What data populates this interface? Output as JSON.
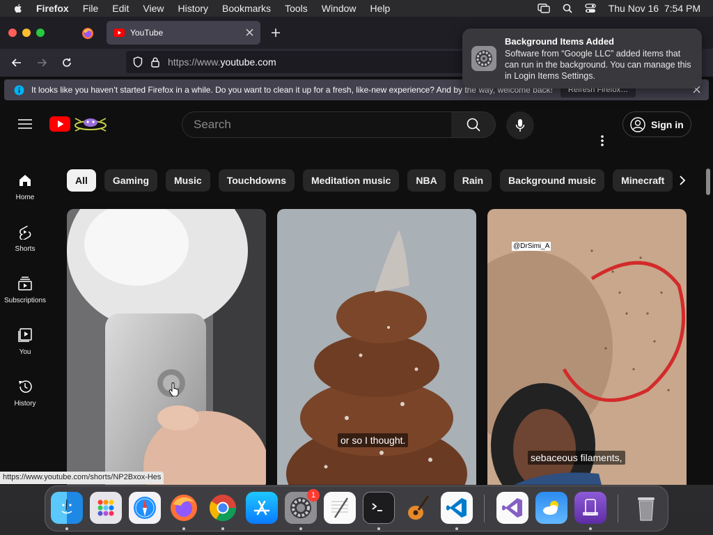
{
  "menubar": {
    "app_name": "Firefox",
    "items": [
      "File",
      "Edit",
      "View",
      "History",
      "Bookmarks",
      "Tools",
      "Window",
      "Help"
    ],
    "clock": "Thu Nov 16  7:54 PM"
  },
  "browser": {
    "tab_title": "YouTube",
    "url_prefix": "https://www.",
    "url_domain": "youtube.com",
    "infobar_text": "It looks like you haven’t started Firefox in a while. Do you want to clean it up for a fresh, like-new experience? And by the way, welcome back!",
    "infobar_button": "Refresh Firefox…",
    "status_link": "https://www.youtube.com/shorts/NP2Bxox-Hes"
  },
  "notification": {
    "title": "Background Items Added",
    "body": "Software from “Google LLC” added items that can run in the background. You can manage this in Login Items Settings."
  },
  "youtube": {
    "search_placeholder": "Search",
    "sign_in": "Sign in",
    "chips": [
      "All",
      "Gaming",
      "Music",
      "Touchdowns",
      "Meditation music",
      "NBA",
      "Rain",
      "Background music",
      "Minecraft"
    ],
    "nav": [
      {
        "label": "Home",
        "icon": "home-icon"
      },
      {
        "label": "Shorts",
        "icon": "shorts-icon"
      },
      {
        "label": "Subscriptions",
        "icon": "subscriptions-icon"
      },
      {
        "label": "You",
        "icon": "you-icon"
      },
      {
        "label": "History",
        "icon": "history-icon"
      }
    ],
    "shorts": [
      {
        "caption": ""
      },
      {
        "caption": "or so I thought."
      },
      {
        "caption": "sebaceous filaments,",
        "watermark": "@DrSimi_A"
      }
    ]
  },
  "dock": {
    "apps": [
      "finder-icon",
      "launchpad-icon",
      "safari-icon",
      "firefox-icon",
      "chrome-icon",
      "app-store-icon",
      "system-settings-icon",
      "textedit-icon",
      "terminal-icon",
      "garageband-icon",
      "vscode-icon",
      "visual-studio-icon",
      "weather-icon",
      "simulator-icon",
      "trash-icon"
    ],
    "settings_badge": "1"
  },
  "colors": {
    "yt_bg": "#0f0f0f",
    "yt_red": "#ff0000",
    "chip_bg": "#272727",
    "firefox_toolbar": "#2b2a33"
  }
}
